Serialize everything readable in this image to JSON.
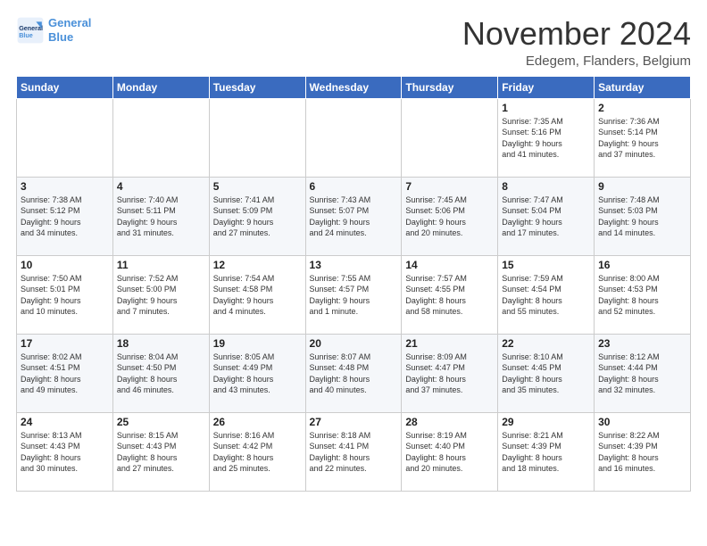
{
  "logo": {
    "line1": "General",
    "line2": "Blue"
  },
  "title": "November 2024",
  "location": "Edegem, Flanders, Belgium",
  "days_header": [
    "Sunday",
    "Monday",
    "Tuesday",
    "Wednesday",
    "Thursday",
    "Friday",
    "Saturday"
  ],
  "weeks": [
    [
      {
        "day": "",
        "content": ""
      },
      {
        "day": "",
        "content": ""
      },
      {
        "day": "",
        "content": ""
      },
      {
        "day": "",
        "content": ""
      },
      {
        "day": "",
        "content": ""
      },
      {
        "day": "1",
        "content": "Sunrise: 7:35 AM\nSunset: 5:16 PM\nDaylight: 9 hours\nand 41 minutes."
      },
      {
        "day": "2",
        "content": "Sunrise: 7:36 AM\nSunset: 5:14 PM\nDaylight: 9 hours\nand 37 minutes."
      }
    ],
    [
      {
        "day": "3",
        "content": "Sunrise: 7:38 AM\nSunset: 5:12 PM\nDaylight: 9 hours\nand 34 minutes."
      },
      {
        "day": "4",
        "content": "Sunrise: 7:40 AM\nSunset: 5:11 PM\nDaylight: 9 hours\nand 31 minutes."
      },
      {
        "day": "5",
        "content": "Sunrise: 7:41 AM\nSunset: 5:09 PM\nDaylight: 9 hours\nand 27 minutes."
      },
      {
        "day": "6",
        "content": "Sunrise: 7:43 AM\nSunset: 5:07 PM\nDaylight: 9 hours\nand 24 minutes."
      },
      {
        "day": "7",
        "content": "Sunrise: 7:45 AM\nSunset: 5:06 PM\nDaylight: 9 hours\nand 20 minutes."
      },
      {
        "day": "8",
        "content": "Sunrise: 7:47 AM\nSunset: 5:04 PM\nDaylight: 9 hours\nand 17 minutes."
      },
      {
        "day": "9",
        "content": "Sunrise: 7:48 AM\nSunset: 5:03 PM\nDaylight: 9 hours\nand 14 minutes."
      }
    ],
    [
      {
        "day": "10",
        "content": "Sunrise: 7:50 AM\nSunset: 5:01 PM\nDaylight: 9 hours\nand 10 minutes."
      },
      {
        "day": "11",
        "content": "Sunrise: 7:52 AM\nSunset: 5:00 PM\nDaylight: 9 hours\nand 7 minutes."
      },
      {
        "day": "12",
        "content": "Sunrise: 7:54 AM\nSunset: 4:58 PM\nDaylight: 9 hours\nand 4 minutes."
      },
      {
        "day": "13",
        "content": "Sunrise: 7:55 AM\nSunset: 4:57 PM\nDaylight: 9 hours\nand 1 minute."
      },
      {
        "day": "14",
        "content": "Sunrise: 7:57 AM\nSunset: 4:55 PM\nDaylight: 8 hours\nand 58 minutes."
      },
      {
        "day": "15",
        "content": "Sunrise: 7:59 AM\nSunset: 4:54 PM\nDaylight: 8 hours\nand 55 minutes."
      },
      {
        "day": "16",
        "content": "Sunrise: 8:00 AM\nSunset: 4:53 PM\nDaylight: 8 hours\nand 52 minutes."
      }
    ],
    [
      {
        "day": "17",
        "content": "Sunrise: 8:02 AM\nSunset: 4:51 PM\nDaylight: 8 hours\nand 49 minutes."
      },
      {
        "day": "18",
        "content": "Sunrise: 8:04 AM\nSunset: 4:50 PM\nDaylight: 8 hours\nand 46 minutes."
      },
      {
        "day": "19",
        "content": "Sunrise: 8:05 AM\nSunset: 4:49 PM\nDaylight: 8 hours\nand 43 minutes."
      },
      {
        "day": "20",
        "content": "Sunrise: 8:07 AM\nSunset: 4:48 PM\nDaylight: 8 hours\nand 40 minutes."
      },
      {
        "day": "21",
        "content": "Sunrise: 8:09 AM\nSunset: 4:47 PM\nDaylight: 8 hours\nand 37 minutes."
      },
      {
        "day": "22",
        "content": "Sunrise: 8:10 AM\nSunset: 4:45 PM\nDaylight: 8 hours\nand 35 minutes."
      },
      {
        "day": "23",
        "content": "Sunrise: 8:12 AM\nSunset: 4:44 PM\nDaylight: 8 hours\nand 32 minutes."
      }
    ],
    [
      {
        "day": "24",
        "content": "Sunrise: 8:13 AM\nSunset: 4:43 PM\nDaylight: 8 hours\nand 30 minutes."
      },
      {
        "day": "25",
        "content": "Sunrise: 8:15 AM\nSunset: 4:43 PM\nDaylight: 8 hours\nand 27 minutes."
      },
      {
        "day": "26",
        "content": "Sunrise: 8:16 AM\nSunset: 4:42 PM\nDaylight: 8 hours\nand 25 minutes."
      },
      {
        "day": "27",
        "content": "Sunrise: 8:18 AM\nSunset: 4:41 PM\nDaylight: 8 hours\nand 22 minutes."
      },
      {
        "day": "28",
        "content": "Sunrise: 8:19 AM\nSunset: 4:40 PM\nDaylight: 8 hours\nand 20 minutes."
      },
      {
        "day": "29",
        "content": "Sunrise: 8:21 AM\nSunset: 4:39 PM\nDaylight: 8 hours\nand 18 minutes."
      },
      {
        "day": "30",
        "content": "Sunrise: 8:22 AM\nSunset: 4:39 PM\nDaylight: 8 hours\nand 16 minutes."
      }
    ]
  ]
}
